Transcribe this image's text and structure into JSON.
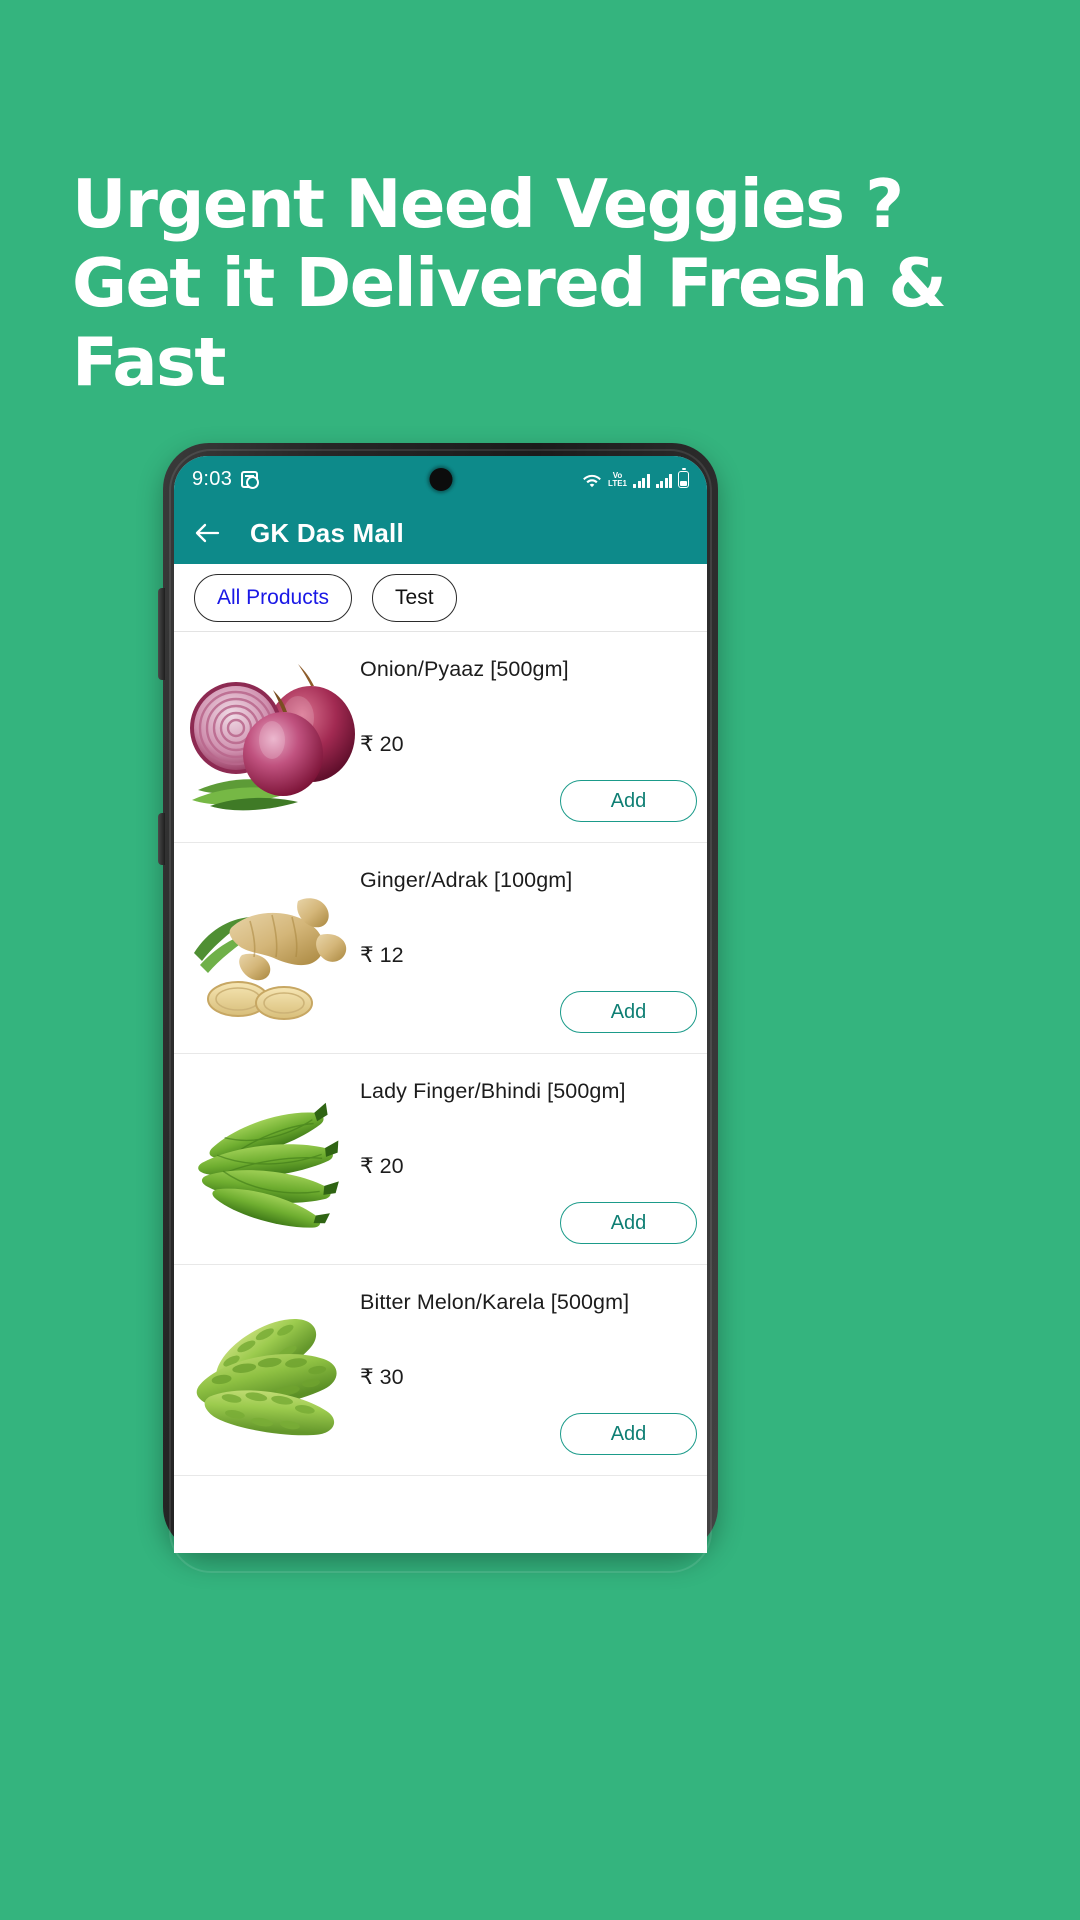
{
  "promo": {
    "lines": [
      "Urgent Need Veggies ?",
      "Get it Delivered Fresh &",
      "Fast"
    ],
    "background_color": "#34b47e",
    "text_color": "#ffffff"
  },
  "phone": {
    "statusbar": {
      "time": "9:03",
      "icons": [
        "note-check-icon",
        "wifi-icon",
        "volte-icon",
        "signal-bars-icon",
        "signal-bars-icon",
        "battery-icon"
      ],
      "volte_label": "Vo",
      "volte_sub": "LTE1",
      "background_color": "#0d8a8a"
    },
    "appbar": {
      "back_icon": "back-arrow-icon",
      "title": "GK Das Mall",
      "background_color": "#0d8a8a",
      "text_color": "#ffffff"
    },
    "chips": [
      {
        "label": "All Products",
        "active": true,
        "color": "#1a18e6"
      },
      {
        "label": "Test",
        "active": false,
        "color": "#111111"
      }
    ],
    "products": [
      {
        "name": "Onion/Pyaaz [500gm]",
        "price": "₹ 20",
        "add_label": "Add",
        "image": "onion-image"
      },
      {
        "name": "Ginger/Adrak [100gm]",
        "price": "₹ 12",
        "add_label": "Add",
        "image": "ginger-image"
      },
      {
        "name": "Lady Finger/Bhindi [500gm]",
        "price": "₹ 20",
        "add_label": "Add",
        "image": "okra-image"
      },
      {
        "name": "Bitter Melon/Karela [500gm]",
        "price": "₹ 30",
        "add_label": "Add",
        "image": "bittermelon-image"
      }
    ],
    "accent_color": "#1b9b8a"
  }
}
